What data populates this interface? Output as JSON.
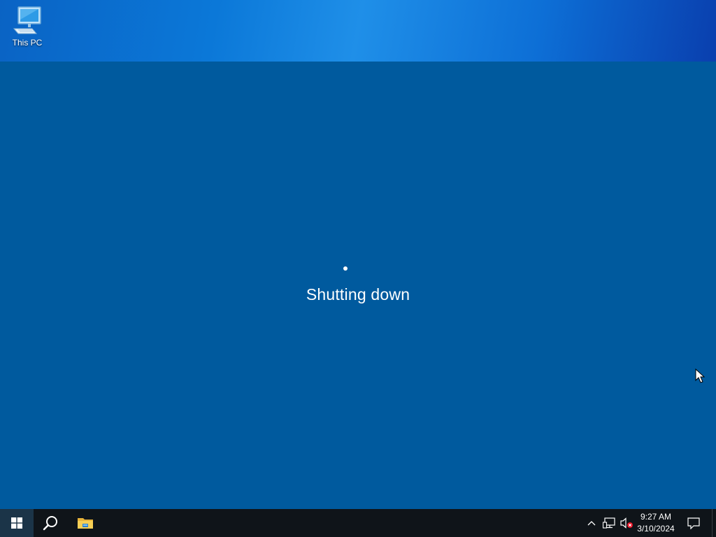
{
  "desktop": {
    "icons": [
      {
        "label": "This PC",
        "icon": "this-pc-icon"
      }
    ]
  },
  "shutdown": {
    "status_text": "Shutting down"
  },
  "taskbar": {
    "start_icon": "windows-logo-icon",
    "search_icon": "search-icon",
    "pinned": [
      {
        "name": "File Explorer",
        "icon": "folder-icon"
      }
    ],
    "tray": {
      "icons": [
        "chevron-up-icon",
        "network-icon",
        "volume-muted-icon"
      ],
      "time": "9:27 AM",
      "date": "3/10/2024",
      "notification_icon": "action-center-icon"
    }
  },
  "colors": {
    "overlay": "#005a9e",
    "taskbar": "#0f1419",
    "wallpaper_accent": "#0b78d8"
  }
}
